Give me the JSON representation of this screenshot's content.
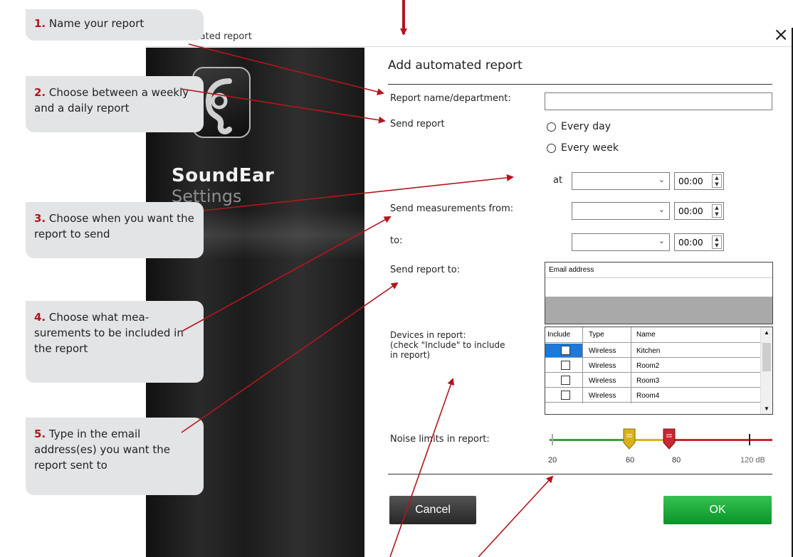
{
  "window": {
    "title": "mated report",
    "close_glyph": "×"
  },
  "side_panel": {
    "brand_name": "SoundEar",
    "brand_sub": "Settings",
    "logo_icon": "ear-icon"
  },
  "dialog": {
    "title": "Add automated report",
    "report_name_label": "Report name/department:",
    "report_name_value": "",
    "send_report_label": "Send report",
    "radio_every_day": "Every day",
    "radio_every_week": "Every week",
    "at_label": "at",
    "at_time": "00:00",
    "measurements_from_label": "Send measurements from:",
    "from_time": "00:00",
    "to_label": "to:",
    "to_time": "00:00",
    "send_to_label": "Send report to:",
    "email_header": "Email address",
    "devices_label_1": "Devices in report:",
    "devices_label_2": "(check \"Include\" to include",
    "devices_label_3": "in report)",
    "devices_columns": [
      "Include",
      "Type",
      "Name"
    ],
    "devices": [
      {
        "type": "Wireless",
        "name": "Kitchen"
      },
      {
        "type": "Wireless",
        "name": "Room2"
      },
      {
        "type": "Wireless",
        "name": "Room3"
      },
      {
        "type": "Wireless",
        "name": "Room4"
      }
    ],
    "noise_label": "Noise limits in report:",
    "noise_ticks": {
      "t20": "20",
      "t60": "60",
      "t80": "80",
      "t120": "120 dB"
    },
    "noise_limits": {
      "min": 20,
      "max": 120,
      "lower": 60,
      "upper": 80
    },
    "cancel_label": "Cancel",
    "ok_label": "OK",
    "colors": {
      "green": "#3e9e3e",
      "yellow": "#d9b21a",
      "red": "#c8282e",
      "ok_button": "#1aa33a",
      "annotation": "#b3161d"
    }
  },
  "callouts": [
    {
      "num": "1.",
      "text": "Name your report"
    },
    {
      "num": "2.",
      "text": "Choose between a weekly and a daily report"
    },
    {
      "num": "3.",
      "text": "Choose when you want the report to send"
    },
    {
      "num": "4.",
      "text": "Choose what mea-surements to be included in the report"
    },
    {
      "num": "5.",
      "text": "Type in the email address(es) you want the report sent to"
    }
  ]
}
